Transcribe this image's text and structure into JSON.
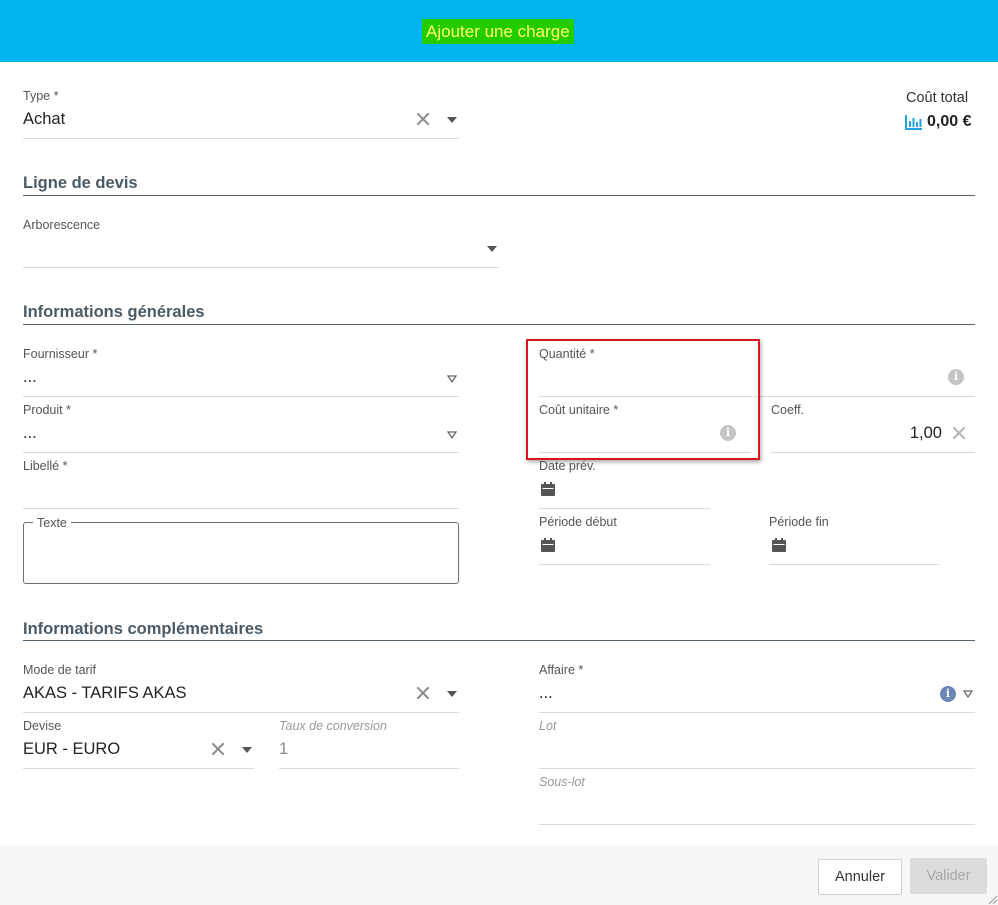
{
  "header": {
    "title": "Ajouter une charge"
  },
  "summary": {
    "total_label": "Coût total",
    "total_value": "0,00 €"
  },
  "type_field": {
    "label": "Type *",
    "value": "Achat"
  },
  "sections": {
    "quote_line": "Ligne de devis",
    "general": "Informations générales",
    "complementary": "Informations complémentaires"
  },
  "tree_field": {
    "label": "Arborescence",
    "value": ""
  },
  "supplier_field": {
    "label": "Fournisseur *",
    "value": "..."
  },
  "product_field": {
    "label": "Produit *",
    "value": "..."
  },
  "wording_field": {
    "label": "Libellé *",
    "value": ""
  },
  "text_field": {
    "label": "Texte",
    "value": ""
  },
  "quantity_field": {
    "label": "Quantité *",
    "value": ""
  },
  "unit_cost_field": {
    "label": "Coût unitaire *",
    "value": ""
  },
  "coeff_field": {
    "label": "Coeff.",
    "value": "1,00"
  },
  "planned_date_field": {
    "label": "Date prév.",
    "value": ""
  },
  "period_start_field": {
    "label": "Période début",
    "value": ""
  },
  "period_end_field": {
    "label": "Période fin",
    "value": ""
  },
  "rate_mode_field": {
    "label": "Mode de tarif",
    "value": "AKAS - TARIFS AKAS"
  },
  "currency_field": {
    "label": "Devise",
    "value": "EUR - EURO"
  },
  "conversion_rate_field": {
    "label": "Taux de conversion",
    "value": "1"
  },
  "business_field": {
    "label": "Affaire *",
    "value": "..."
  },
  "lot_field": {
    "label": "Lot",
    "value": ""
  },
  "sublot_field": {
    "label": "Sous-lot",
    "value": ""
  },
  "footer": {
    "cancel_label": "Annuler",
    "validate_label": "Valider"
  },
  "colors": {
    "header_bg": "#00b4f0",
    "title_bg": "#22cc00",
    "title_text": "#ffff66",
    "highlight": "#d9151e",
    "chart_icon": "#1ea7e4"
  },
  "icons": [
    "chart-icon",
    "clear-icon",
    "dropdown-caret-icon",
    "info-icon",
    "calendar-icon",
    "resize-grip-icon"
  ]
}
